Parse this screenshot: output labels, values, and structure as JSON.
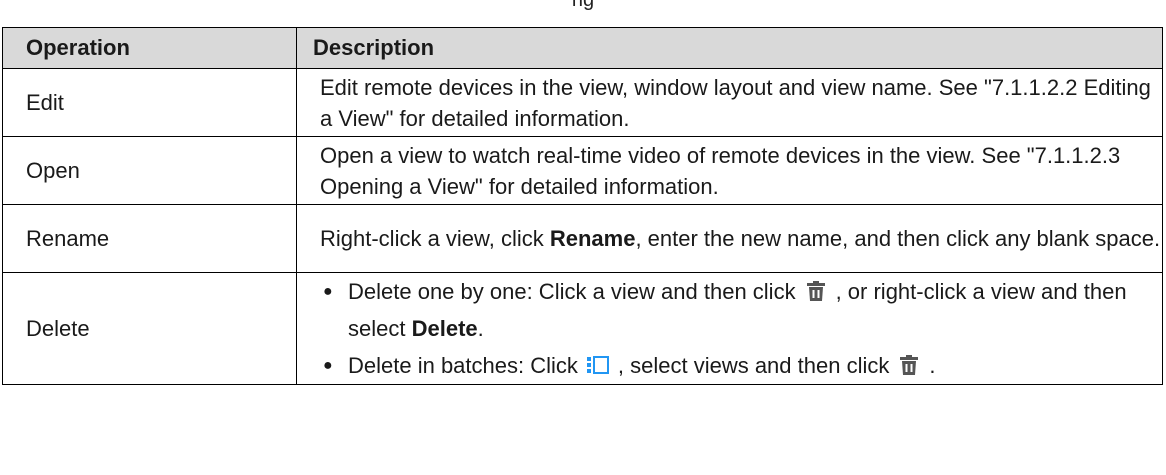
{
  "caption_fragment": "ng",
  "table": {
    "headers": [
      "Operation",
      "Description"
    ],
    "rows": {
      "edit": {
        "operation": "Edit",
        "description": "Edit remote devices in the view, window layout and view name. See \"7.1.1.2.2 Editing a View\" for detailed information."
      },
      "open": {
        "operation": "Open",
        "description": "Open a view to watch real-time video of remote devices in the view. See \"7.1.1.2.3 Opening a View\" for detailed information."
      },
      "rename": {
        "operation": "Rename",
        "desc_pre": "Right-click a view, click ",
        "desc_bold": "Rename",
        "desc_post": ", enter the new name, and then click any blank space."
      },
      "delete": {
        "operation": "Delete",
        "bullet_glyph": "●",
        "b1_pre": "Delete one by one: Click a view and then click",
        "b1_mid": ", or right-click a view and then select ",
        "b1_bold": "Delete",
        "b1_post": ".",
        "b2_pre": "Delete in batches: Click",
        "b2_mid": ", select views and then click",
        "b2_post": "."
      }
    }
  },
  "icons": {
    "delete": "trash-icon",
    "batch": "batch-select-icon"
  },
  "colors": {
    "header_bg": "#d9d9d9",
    "trash_icon": "#555555",
    "batch_icon": "#2196f3"
  }
}
